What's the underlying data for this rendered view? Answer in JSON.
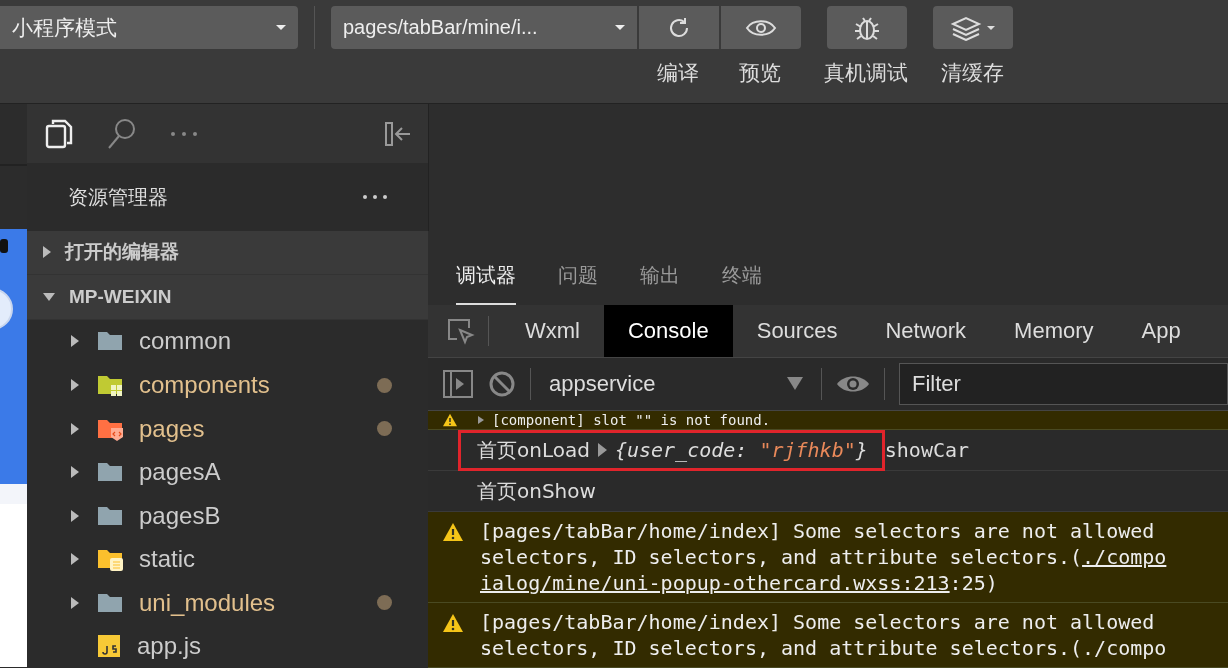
{
  "toolbar": {
    "mode_select": "小程序模式",
    "page_select": "pages/tabBar/mine/i...",
    "actions": [
      {
        "kind": "refresh",
        "label": "编译"
      },
      {
        "kind": "preview",
        "label": "预览"
      },
      {
        "kind": "debug",
        "label": "真机调试"
      },
      {
        "kind": "cache",
        "label": "清缓存"
      }
    ]
  },
  "explorer": {
    "title": "资源管理器",
    "sections": [
      {
        "label": "打开的编辑器",
        "expanded": false
      },
      {
        "label": "MP-WEIXIN",
        "expanded": true
      }
    ],
    "items": [
      {
        "name": "common",
        "kind": "folder",
        "modified": false
      },
      {
        "name": "components",
        "kind": "components",
        "modified": true
      },
      {
        "name": "pages",
        "kind": "pages",
        "modified": true
      },
      {
        "name": "pagesA",
        "kind": "folder",
        "modified": false
      },
      {
        "name": "pagesB",
        "kind": "folder",
        "modified": false
      },
      {
        "name": "static",
        "kind": "static",
        "modified": false
      },
      {
        "name": "uni_modules",
        "kind": "folder",
        "modified": true
      },
      {
        "name": "app.js",
        "kind": "js",
        "modified": false
      }
    ]
  },
  "panel_tabs": [
    {
      "label": "调试器",
      "selected": true
    },
    {
      "label": "问题",
      "selected": false
    },
    {
      "label": "输出",
      "selected": false
    },
    {
      "label": "终端",
      "selected": false
    }
  ],
  "devtools_tabs": [
    {
      "label": "Wxml",
      "selected": false
    },
    {
      "label": "Console",
      "selected": true
    },
    {
      "label": "Sources",
      "selected": false
    },
    {
      "label": "Network",
      "selected": false
    },
    {
      "label": "Memory",
      "selected": false
    },
    {
      "label": "App",
      "selected": false
    }
  ],
  "console_bar": {
    "context": "appservice",
    "filter": {
      "placeholder": "Filter"
    }
  },
  "console": [
    {
      "kind": "warning",
      "lines": [
        "[component] slot \"\" is not found."
      ]
    },
    {
      "kind": "object",
      "highlighted": true,
      "prefix": "首页onLoad",
      "key": "{user_code: ",
      "value": "\"rjfhkb\"",
      "close": "}",
      "suffix": "showCar"
    },
    {
      "kind": "log",
      "lines": [
        "首页onShow"
      ]
    },
    {
      "kind": "warning",
      "lines": [
        "[pages/tabBar/home/index] Some selectors are not allowed"
      ],
      "line2": "selectors, ID selectors, and attribute selectors.(",
      "link": "./compo",
      "line3_link": "ialog/mine/uni-popup-othercard.wxss:213",
      "line3_rest": ":25)"
    },
    {
      "kind": "warning",
      "lines": [
        "[pages/tabBar/home/index] Some selectors are not allowed",
        "selectors, ID selectors, and attribute selectors.(./compo"
      ]
    }
  ]
}
